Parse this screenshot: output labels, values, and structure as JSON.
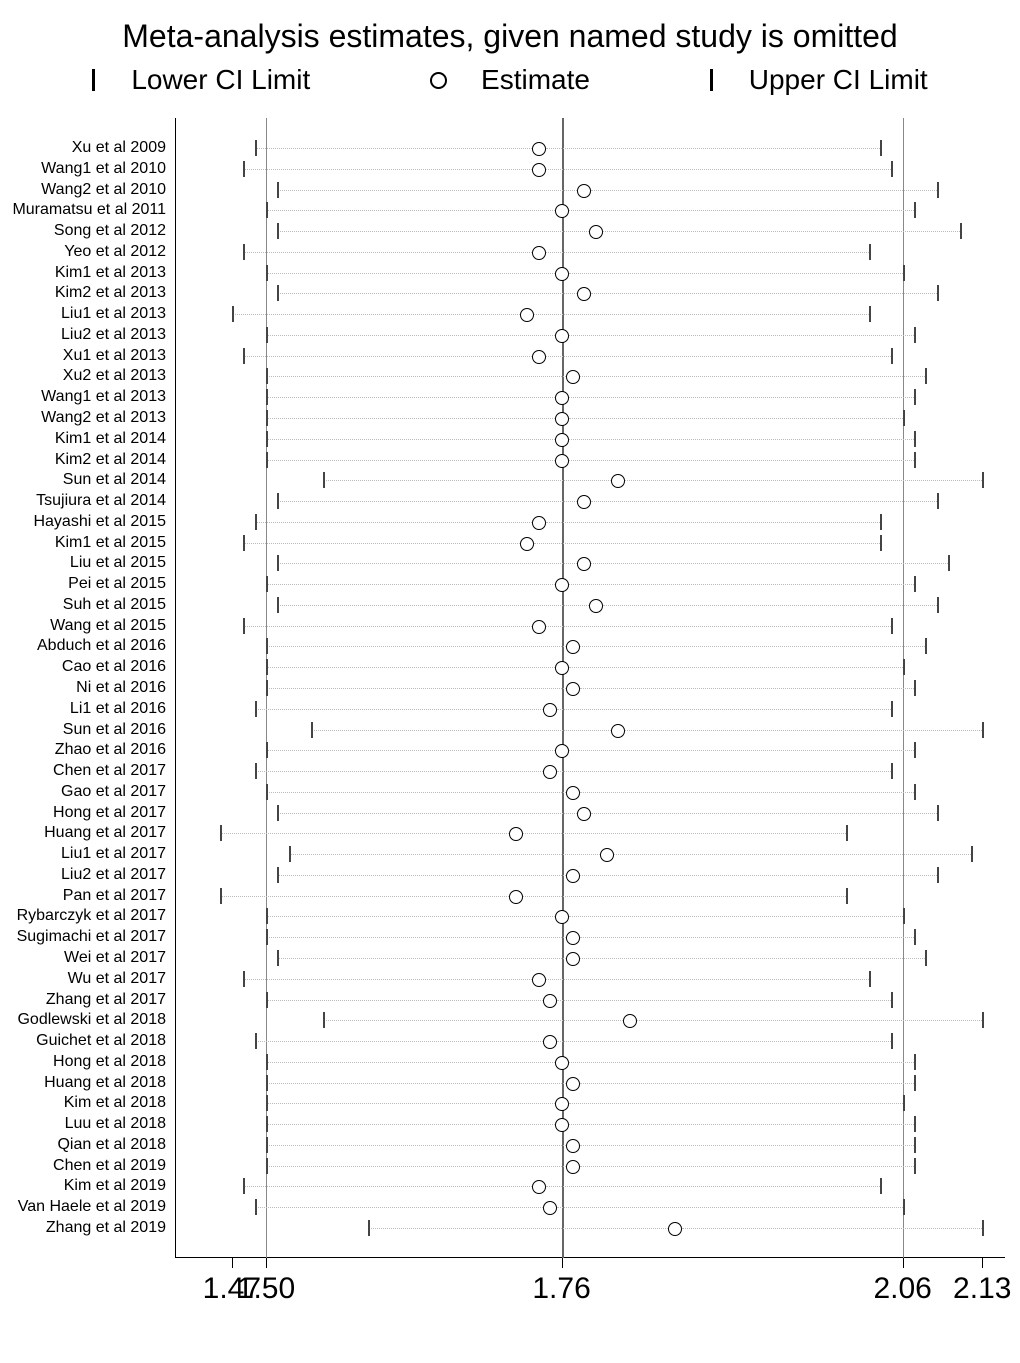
{
  "chart_data": {
    "type": "forest",
    "title": "Meta-analysis estimates, given named study is omitted",
    "legend": {
      "lower": "Lower CI Limit",
      "estimate": "Estimate",
      "upper": "Upper CI Limit"
    },
    "xaxis": {
      "min": 1.42,
      "max": 2.15,
      "ticks": [
        1.47,
        1.5,
        1.76,
        2.06,
        2.13
      ],
      "tick_labels": [
        "1.47",
        "1.50",
        "1.76",
        "2.06",
        "2.13"
      ]
    },
    "reference_lines": {
      "overall_lower": 1.5,
      "overall_estimate": 1.76,
      "overall_upper": 2.06
    },
    "studies": [
      {
        "label": "Xu et al 2009",
        "lower": 1.49,
        "est": 1.74,
        "upper": 2.04
      },
      {
        "label": "Wang1 et al 2010",
        "lower": 1.48,
        "est": 1.74,
        "upper": 2.05
      },
      {
        "label": "Wang2 et al 2010",
        "lower": 1.51,
        "est": 1.78,
        "upper": 2.09
      },
      {
        "label": "Muramatsu et al 2011",
        "lower": 1.5,
        "est": 1.76,
        "upper": 2.07
      },
      {
        "label": "Song et al 2012",
        "lower": 1.51,
        "est": 1.79,
        "upper": 2.11
      },
      {
        "label": "Yeo et al 2012",
        "lower": 1.48,
        "est": 1.74,
        "upper": 2.03
      },
      {
        "label": "Kim1 et al 2013",
        "lower": 1.5,
        "est": 1.76,
        "upper": 2.06
      },
      {
        "label": "Kim2 et al 2013",
        "lower": 1.51,
        "est": 1.78,
        "upper": 2.09
      },
      {
        "label": "Liu1 et al 2013",
        "lower": 1.47,
        "est": 1.73,
        "upper": 2.03
      },
      {
        "label": "Liu2 et al 2013",
        "lower": 1.5,
        "est": 1.76,
        "upper": 2.07
      },
      {
        "label": "Xu1 et al 2013",
        "lower": 1.48,
        "est": 1.74,
        "upper": 2.05
      },
      {
        "label": "Xu2 et al 2013",
        "lower": 1.5,
        "est": 1.77,
        "upper": 2.08
      },
      {
        "label": "Wang1 et al 2013",
        "lower": 1.5,
        "est": 1.76,
        "upper": 2.07
      },
      {
        "label": "Wang2 et al 2013",
        "lower": 1.5,
        "est": 1.76,
        "upper": 2.06
      },
      {
        "label": "Kim1 et al 2014",
        "lower": 1.5,
        "est": 1.76,
        "upper": 2.07
      },
      {
        "label": "Kim2 et al 2014",
        "lower": 1.5,
        "est": 1.76,
        "upper": 2.07
      },
      {
        "label": "Sun et al 2014",
        "lower": 1.55,
        "est": 1.81,
        "upper": 2.13
      },
      {
        "label": "Tsujiura et al 2014",
        "lower": 1.51,
        "est": 1.78,
        "upper": 2.09
      },
      {
        "label": "Hayashi et al 2015",
        "lower": 1.49,
        "est": 1.74,
        "upper": 2.04
      },
      {
        "label": "Kim1 et al 2015",
        "lower": 1.48,
        "est": 1.73,
        "upper": 2.04
      },
      {
        "label": "Liu et al 2015",
        "lower": 1.51,
        "est": 1.78,
        "upper": 2.1
      },
      {
        "label": "Pei et al 2015",
        "lower": 1.5,
        "est": 1.76,
        "upper": 2.07
      },
      {
        "label": "Suh et al 2015",
        "lower": 1.51,
        "est": 1.79,
        "upper": 2.09
      },
      {
        "label": "Wang et al 2015",
        "lower": 1.48,
        "est": 1.74,
        "upper": 2.05
      },
      {
        "label": "Abduch et al 2016",
        "lower": 1.5,
        "est": 1.77,
        "upper": 2.08
      },
      {
        "label": "Cao et al 2016",
        "lower": 1.5,
        "est": 1.76,
        "upper": 2.06
      },
      {
        "label": "Ni et al 2016",
        "lower": 1.5,
        "est": 1.77,
        "upper": 2.07
      },
      {
        "label": "Li1 et al 2016",
        "lower": 1.49,
        "est": 1.75,
        "upper": 2.05
      },
      {
        "label": "Sun et al 2016",
        "lower": 1.54,
        "est": 1.81,
        "upper": 2.13
      },
      {
        "label": "Zhao et al 2016",
        "lower": 1.5,
        "est": 1.76,
        "upper": 2.07
      },
      {
        "label": "Chen et al 2017",
        "lower": 1.49,
        "est": 1.75,
        "upper": 2.05
      },
      {
        "label": "Gao et al 2017",
        "lower": 1.5,
        "est": 1.77,
        "upper": 2.07
      },
      {
        "label": "Hong et al 2017",
        "lower": 1.51,
        "est": 1.78,
        "upper": 2.09
      },
      {
        "label": "Huang et al 2017",
        "lower": 1.46,
        "est": 1.72,
        "upper": 2.01
      },
      {
        "label": "Liu1 et al 2017",
        "lower": 1.52,
        "est": 1.8,
        "upper": 2.12
      },
      {
        "label": "Liu2 et al 2017",
        "lower": 1.51,
        "est": 1.77,
        "upper": 2.09
      },
      {
        "label": "Pan et al 2017",
        "lower": 1.46,
        "est": 1.72,
        "upper": 2.01
      },
      {
        "label": "Rybarczyk et al 2017",
        "lower": 1.5,
        "est": 1.76,
        "upper": 2.06
      },
      {
        "label": "Sugimachi et al 2017",
        "lower": 1.5,
        "est": 1.77,
        "upper": 2.07
      },
      {
        "label": "Wei et al 2017",
        "lower": 1.51,
        "est": 1.77,
        "upper": 2.08
      },
      {
        "label": "Wu et al 2017",
        "lower": 1.48,
        "est": 1.74,
        "upper": 2.03
      },
      {
        "label": "Zhang et al 2017",
        "lower": 1.5,
        "est": 1.75,
        "upper": 2.05
      },
      {
        "label": "Godlewski et al 2018",
        "lower": 1.55,
        "est": 1.82,
        "upper": 2.13
      },
      {
        "label": "Guichet et al 2018",
        "lower": 1.49,
        "est": 1.75,
        "upper": 2.05
      },
      {
        "label": "Hong et al 2018",
        "lower": 1.5,
        "est": 1.76,
        "upper": 2.07
      },
      {
        "label": "Huang et al 2018",
        "lower": 1.5,
        "est": 1.77,
        "upper": 2.07
      },
      {
        "label": "Kim et al 2018",
        "lower": 1.5,
        "est": 1.76,
        "upper": 2.06
      },
      {
        "label": "Luu et al 2018",
        "lower": 1.5,
        "est": 1.76,
        "upper": 2.07
      },
      {
        "label": "Qian et al 2018",
        "lower": 1.5,
        "est": 1.77,
        "upper": 2.07
      },
      {
        "label": "Chen et al 2019",
        "lower": 1.5,
        "est": 1.77,
        "upper": 2.07
      },
      {
        "label": "Kim et al 2019",
        "lower": 1.48,
        "est": 1.74,
        "upper": 2.04
      },
      {
        "label": "Van Haele et al 2019",
        "lower": 1.49,
        "est": 1.75,
        "upper": 2.06
      },
      {
        "label": "Zhang et al 2019",
        "lower": 1.59,
        "est": 1.86,
        "upper": 2.13
      }
    ]
  }
}
